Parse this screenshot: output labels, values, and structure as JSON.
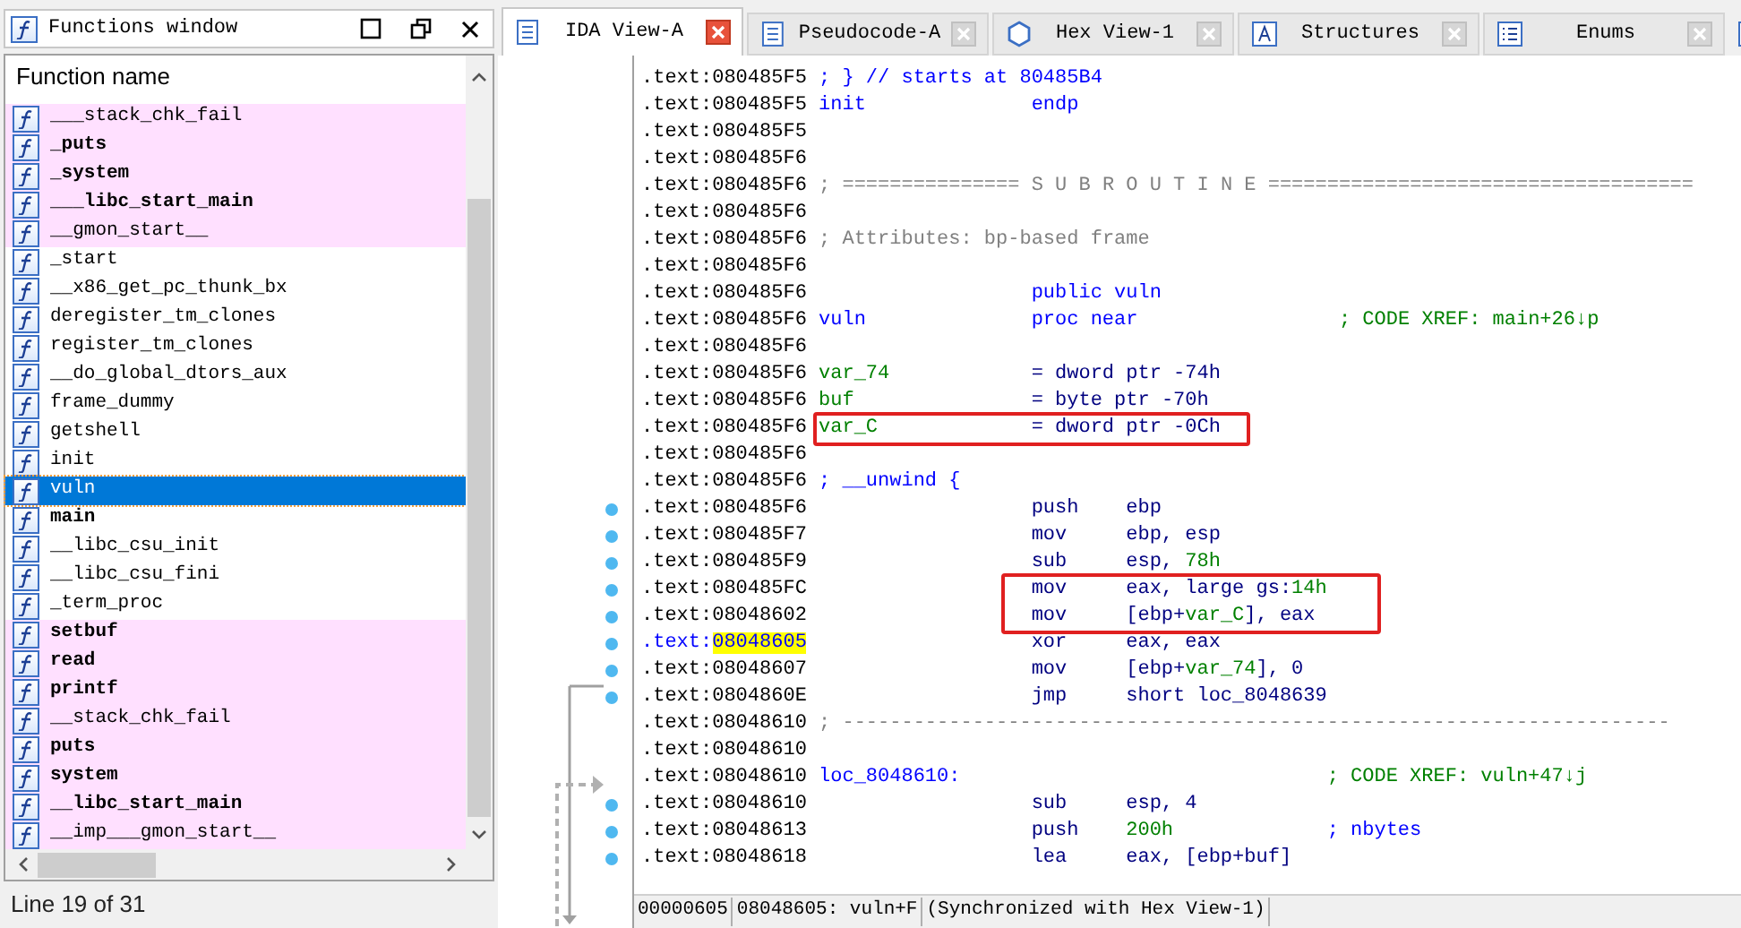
{
  "functions_window": {
    "title": "Functions window",
    "column": "Function name",
    "status": "Line 19 of 31",
    "items": [
      {
        "name": "___stack_chk_fail",
        "bold": false,
        "imported": true,
        "selected": false
      },
      {
        "name": "_puts",
        "bold": true,
        "imported": true,
        "selected": false
      },
      {
        "name": "_system",
        "bold": true,
        "imported": true,
        "selected": false
      },
      {
        "name": "___libc_start_main",
        "bold": true,
        "imported": true,
        "selected": false
      },
      {
        "name": "__gmon_start__",
        "bold": false,
        "imported": true,
        "selected": false
      },
      {
        "name": "_start",
        "bold": false,
        "imported": false,
        "selected": false
      },
      {
        "name": "__x86_get_pc_thunk_bx",
        "bold": false,
        "imported": false,
        "selected": false
      },
      {
        "name": "deregister_tm_clones",
        "bold": false,
        "imported": false,
        "selected": false
      },
      {
        "name": "register_tm_clones",
        "bold": false,
        "imported": false,
        "selected": false
      },
      {
        "name": "__do_global_dtors_aux",
        "bold": false,
        "imported": false,
        "selected": false
      },
      {
        "name": "frame_dummy",
        "bold": false,
        "imported": false,
        "selected": false
      },
      {
        "name": "getshell",
        "bold": false,
        "imported": false,
        "selected": false
      },
      {
        "name": "init",
        "bold": false,
        "imported": false,
        "selected": false
      },
      {
        "name": "vuln",
        "bold": false,
        "imported": false,
        "selected": true
      },
      {
        "name": "main",
        "bold": true,
        "imported": false,
        "selected": false
      },
      {
        "name": "__libc_csu_init",
        "bold": false,
        "imported": false,
        "selected": false
      },
      {
        "name": "__libc_csu_fini",
        "bold": false,
        "imported": false,
        "selected": false
      },
      {
        "name": "_term_proc",
        "bold": false,
        "imported": false,
        "selected": false
      },
      {
        "name": "setbuf",
        "bold": true,
        "imported": true,
        "selected": false
      },
      {
        "name": "read",
        "bold": true,
        "imported": true,
        "selected": false
      },
      {
        "name": "printf",
        "bold": true,
        "imported": true,
        "selected": false
      },
      {
        "name": "__stack_chk_fail",
        "bold": false,
        "imported": true,
        "selected": false
      },
      {
        "name": "puts",
        "bold": true,
        "imported": true,
        "selected": false
      },
      {
        "name": "system",
        "bold": true,
        "imported": true,
        "selected": false
      },
      {
        "name": "__libc_start_main",
        "bold": true,
        "imported": true,
        "selected": false
      },
      {
        "name": "__imp___gmon_start__",
        "bold": false,
        "imported": true,
        "selected": false
      }
    ]
  },
  "tabs": [
    {
      "label": "IDA View-A",
      "kind": "listing",
      "selected": true
    },
    {
      "label": "Pseudocode-A",
      "kind": "listing",
      "selected": false
    },
    {
      "label": "Hex View-1",
      "kind": "hex",
      "selected": false
    },
    {
      "label": "Structures",
      "kind": "struct",
      "selected": false
    },
    {
      "label": "Enums",
      "kind": "enum",
      "selected": false
    }
  ],
  "listing": {
    "lines": [
      {
        "segment": ".text:",
        "address": "080485F5",
        "kind": "note",
        "text": "; } // starts at 80485B4",
        "selected": false,
        "dot": false,
        "boxed": false
      },
      {
        "segment": ".text:",
        "address": "080485F5",
        "kind": "code",
        "label": {
          "text": "init",
          "kind": "name"
        },
        "mnemonic": {
          "text": "endp",
          "kind": "directive"
        },
        "selected": false,
        "dot": false,
        "boxed": false
      },
      {
        "segment": ".text:",
        "address": "080485F5",
        "kind": "blank",
        "selected": false,
        "dot": false,
        "boxed": false
      },
      {
        "segment": ".text:",
        "address": "080485F6",
        "kind": "blank",
        "selected": false,
        "dot": false,
        "boxed": false
      },
      {
        "segment": ".text:",
        "address": "080485F6",
        "kind": "comment",
        "text": "; =============== S U B R O U T I N E ====================================",
        "selected": false,
        "dot": false,
        "boxed": false
      },
      {
        "segment": ".text:",
        "address": "080485F6",
        "kind": "blank",
        "selected": false,
        "dot": false,
        "boxed": false
      },
      {
        "segment": ".text:",
        "address": "080485F6",
        "kind": "comment",
        "text": "; Attributes: bp-based frame",
        "selected": false,
        "dot": false,
        "boxed": false
      },
      {
        "segment": ".text:",
        "address": "080485F6",
        "kind": "blank",
        "selected": false,
        "dot": false,
        "boxed": false
      },
      {
        "segment": ".text:",
        "address": "080485F6",
        "kind": "code",
        "mnemonic": {
          "text": "public vuln",
          "kind": "directive"
        },
        "selected": false,
        "dot": false,
        "boxed": false
      },
      {
        "segment": ".text:",
        "address": "080485F6",
        "kind": "code",
        "label": {
          "text": "vuln",
          "kind": "name"
        },
        "mnemonic": {
          "text": "proc near",
          "kind": "directive"
        },
        "comment": {
          "text": "; CODE XREF: main+26↓p",
          "kind": "xref"
        },
        "selected": false,
        "dot": false,
        "boxed": false
      },
      {
        "segment": ".text:",
        "address": "080485F6",
        "kind": "blank",
        "selected": false,
        "dot": false,
        "boxed": false
      },
      {
        "segment": ".text:",
        "address": "080485F6",
        "kind": "code",
        "label": {
          "text": "var_74",
          "kind": "var"
        },
        "mnemonic": {
          "text": "= dword ptr -74h",
          "kind": "insn"
        },
        "selected": false,
        "dot": false,
        "boxed": false
      },
      {
        "segment": ".text:",
        "address": "080485F6",
        "kind": "code",
        "label": {
          "text": "buf",
          "kind": "var"
        },
        "mnemonic": {
          "text": "= byte ptr -70h",
          "kind": "insn"
        },
        "selected": false,
        "dot": false,
        "boxed": false
      },
      {
        "segment": ".text:",
        "address": "080485F6",
        "kind": "code",
        "label": {
          "text": "var_C",
          "kind": "var"
        },
        "mnemonic": {
          "text": "= dword ptr -0Ch",
          "kind": "insn"
        },
        "selected": false,
        "dot": false,
        "boxed": true
      },
      {
        "segment": ".text:",
        "address": "080485F6",
        "kind": "blank",
        "selected": false,
        "dot": false,
        "boxed": false
      },
      {
        "segment": ".text:",
        "address": "080485F6",
        "kind": "note",
        "text": "; __unwind {",
        "selected": false,
        "dot": false,
        "boxed": false
      },
      {
        "segment": ".text:",
        "address": "080485F6",
        "kind": "code",
        "mnemonic": {
          "text": "push",
          "kind": "insn"
        },
        "operands": [
          {
            "text": "ebp",
            "kind": "reg"
          }
        ],
        "selected": false,
        "dot": true,
        "boxed": false
      },
      {
        "segment": ".text:",
        "address": "080485F7",
        "kind": "code",
        "mnemonic": {
          "text": "mov",
          "kind": "insn"
        },
        "operands": [
          {
            "text": "ebp, esp",
            "kind": "reg"
          }
        ],
        "selected": false,
        "dot": true,
        "boxed": false
      },
      {
        "segment": ".text:",
        "address": "080485F9",
        "kind": "code",
        "mnemonic": {
          "text": "sub",
          "kind": "insn"
        },
        "operands": [
          {
            "text": "esp, ",
            "kind": "reg"
          },
          {
            "text": "78h",
            "kind": "num"
          }
        ],
        "selected": false,
        "dot": true,
        "boxed": false
      },
      {
        "segment": ".text:",
        "address": "080485FC",
        "kind": "code",
        "mnemonic": {
          "text": "mov",
          "kind": "insn"
        },
        "operands": [
          {
            "text": "eax, large gs:",
            "kind": "reg"
          },
          {
            "text": "14h",
            "kind": "num"
          }
        ],
        "selected": false,
        "dot": true,
        "boxed": true
      },
      {
        "segment": ".text:",
        "address": "08048602",
        "kind": "code",
        "mnemonic": {
          "text": "mov",
          "kind": "insn"
        },
        "operands": [
          {
            "text": "[ebp+",
            "kind": "reg"
          },
          {
            "text": "var_C",
            "kind": "num"
          },
          {
            "text": "], eax",
            "kind": "reg"
          }
        ],
        "selected": false,
        "dot": true,
        "boxed": true
      },
      {
        "segment": ".text:",
        "address": "08048605",
        "kind": "code",
        "mnemonic": {
          "text": "xor",
          "kind": "insn"
        },
        "operands": [
          {
            "text": "eax, eax",
            "kind": "reg"
          }
        ],
        "selected": true,
        "dot": true,
        "boxed": false
      },
      {
        "segment": ".text:",
        "address": "08048607",
        "kind": "code",
        "mnemonic": {
          "text": "mov",
          "kind": "insn"
        },
        "operands": [
          {
            "text": "[ebp+",
            "kind": "reg"
          },
          {
            "text": "var_74",
            "kind": "num"
          },
          {
            "text": "], 0",
            "kind": "reg"
          }
        ],
        "selected": false,
        "dot": true,
        "boxed": false
      },
      {
        "segment": ".text:",
        "address": "0804860E",
        "kind": "code",
        "mnemonic": {
          "text": "jmp",
          "kind": "insn"
        },
        "operands": [
          {
            "text": "short loc_8048639",
            "kind": "reg"
          }
        ],
        "selected": false,
        "dot": true,
        "boxed": false
      },
      {
        "segment": ".text:",
        "address": "08048610",
        "kind": "comment",
        "text": "; ----------------------------------------------------------------------",
        "selected": false,
        "dot": false,
        "boxed": false
      },
      {
        "segment": ".text:",
        "address": "08048610",
        "kind": "blank",
        "selected": false,
        "dot": false,
        "boxed": false
      },
      {
        "segment": ".text:",
        "address": "08048610",
        "kind": "code",
        "label": {
          "text": "loc_8048610:",
          "kind": "name"
        },
        "comment": {
          "text": "; CODE XREF: vuln+47↓j",
          "kind": "xref"
        },
        "selected": false,
        "dot": false,
        "boxed": false
      },
      {
        "segment": ".text:",
        "address": "08048610",
        "kind": "code",
        "mnemonic": {
          "text": "sub",
          "kind": "insn"
        },
        "operands": [
          {
            "text": "esp, 4",
            "kind": "reg"
          }
        ],
        "selected": false,
        "dot": true,
        "boxed": false
      },
      {
        "segment": ".text:",
        "address": "08048613",
        "kind": "code",
        "mnemonic": {
          "text": "push",
          "kind": "insn"
        },
        "operands": [
          {
            "text": "200h",
            "kind": "num"
          }
        ],
        "comment": {
          "text": "; nbytes",
          "kind": "note"
        },
        "selected": false,
        "dot": true,
        "boxed": false
      },
      {
        "segment": ".text:",
        "address": "08048618",
        "kind": "code",
        "mnemonic": {
          "text": "lea",
          "kind": "insn"
        },
        "operands": [
          {
            "text": "eax, [ebp+buf]",
            "kind": "reg"
          }
        ],
        "selected": false,
        "dot": true,
        "boxed": false
      }
    ]
  },
  "status_bar": [
    "00000605",
    "08048605: vuln+F",
    "(Synchronized with Hex View-1)"
  ]
}
